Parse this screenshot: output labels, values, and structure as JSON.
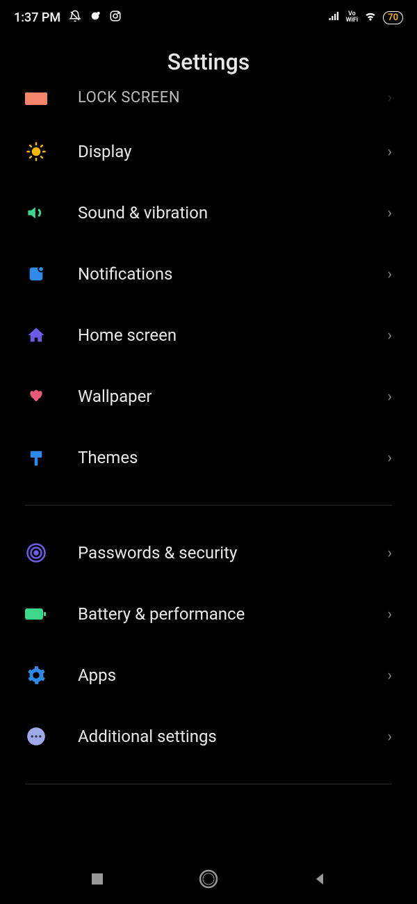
{
  "status": {
    "time": "1:37 PM",
    "battery": "70"
  },
  "header": {
    "title": "Settings"
  },
  "items": [
    {
      "id": "lock-screen",
      "label": "Lock screen",
      "partial": true
    },
    {
      "id": "display",
      "label": "Display"
    },
    {
      "id": "sound",
      "label": "Sound & vibration"
    },
    {
      "id": "notifications",
      "label": "Notifications"
    },
    {
      "id": "home-screen",
      "label": "Home screen"
    },
    {
      "id": "wallpaper",
      "label": "Wallpaper"
    },
    {
      "id": "themes",
      "label": "Themes"
    }
  ],
  "items2": [
    {
      "id": "passwords",
      "label": "Passwords & security"
    },
    {
      "id": "battery",
      "label": "Battery & performance"
    },
    {
      "id": "apps",
      "label": "Apps"
    },
    {
      "id": "additional",
      "label": "Additional settings"
    }
  ]
}
